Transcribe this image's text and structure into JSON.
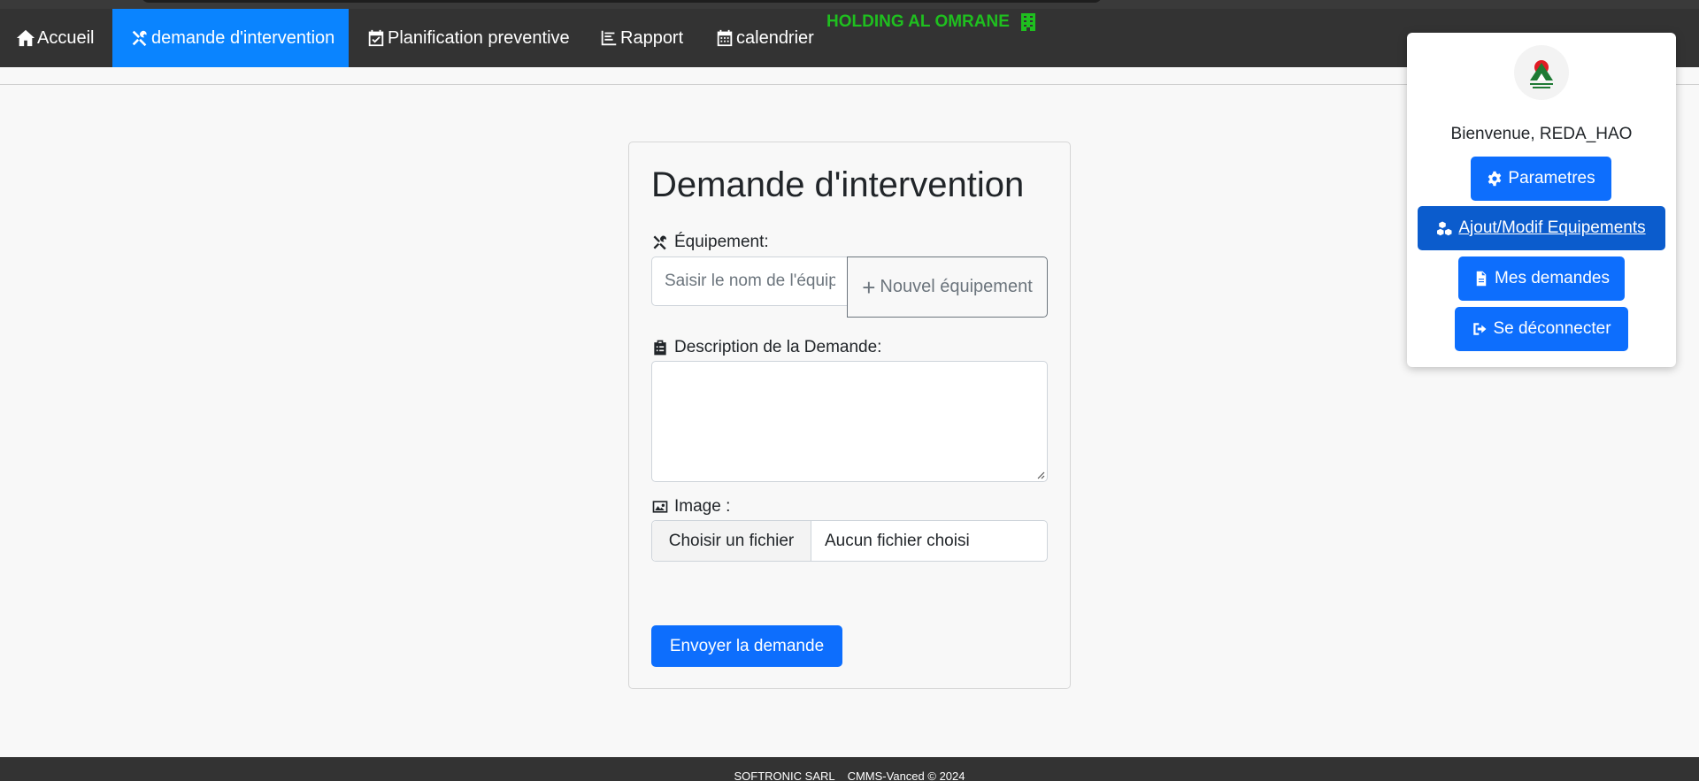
{
  "nav": {
    "items": [
      {
        "label": "Accueil",
        "icon": "home-icon"
      },
      {
        "label": "demande d'intervention",
        "icon": "tools-icon",
        "active": true
      },
      {
        "label": "Planification preventive",
        "icon": "calendar-check-icon"
      },
      {
        "label": "Rapport",
        "icon": "report-icon"
      },
      {
        "label": "calendrier",
        "icon": "calendar-icon"
      }
    ],
    "brand": "HOLDING AL OMRANE",
    "brand_color": "#1fbf1f",
    "active_color": "#0a84ff"
  },
  "form": {
    "title": "Demande d'intervention",
    "equipment_label": "Équipement:",
    "equipment_placeholder": "Saisir le nom de l'équipement",
    "new_equipment_label": "Nouvel équipement",
    "description_label": "Description de la Demande:",
    "description_value": "",
    "image_label": "Image :",
    "file_button": "Choisir un fichier",
    "file_status": "Aucun fichier choisi",
    "submit_label": "Envoyer la demande"
  },
  "user_panel": {
    "welcome": "Bienvenue, REDA_HAO",
    "buttons": [
      {
        "label": "Parametres",
        "icon": "gear-icon"
      },
      {
        "label": "Ajout/Modif Equipements",
        "icon": "cubes-icon"
      },
      {
        "label": "Mes demandes",
        "icon": "file-icon"
      },
      {
        "label": "Se déconnecter",
        "icon": "logout-icon"
      }
    ]
  },
  "footer": {
    "company": "SOFTRONIC SARL",
    "product": "CMMS-Vanced © 2024"
  }
}
